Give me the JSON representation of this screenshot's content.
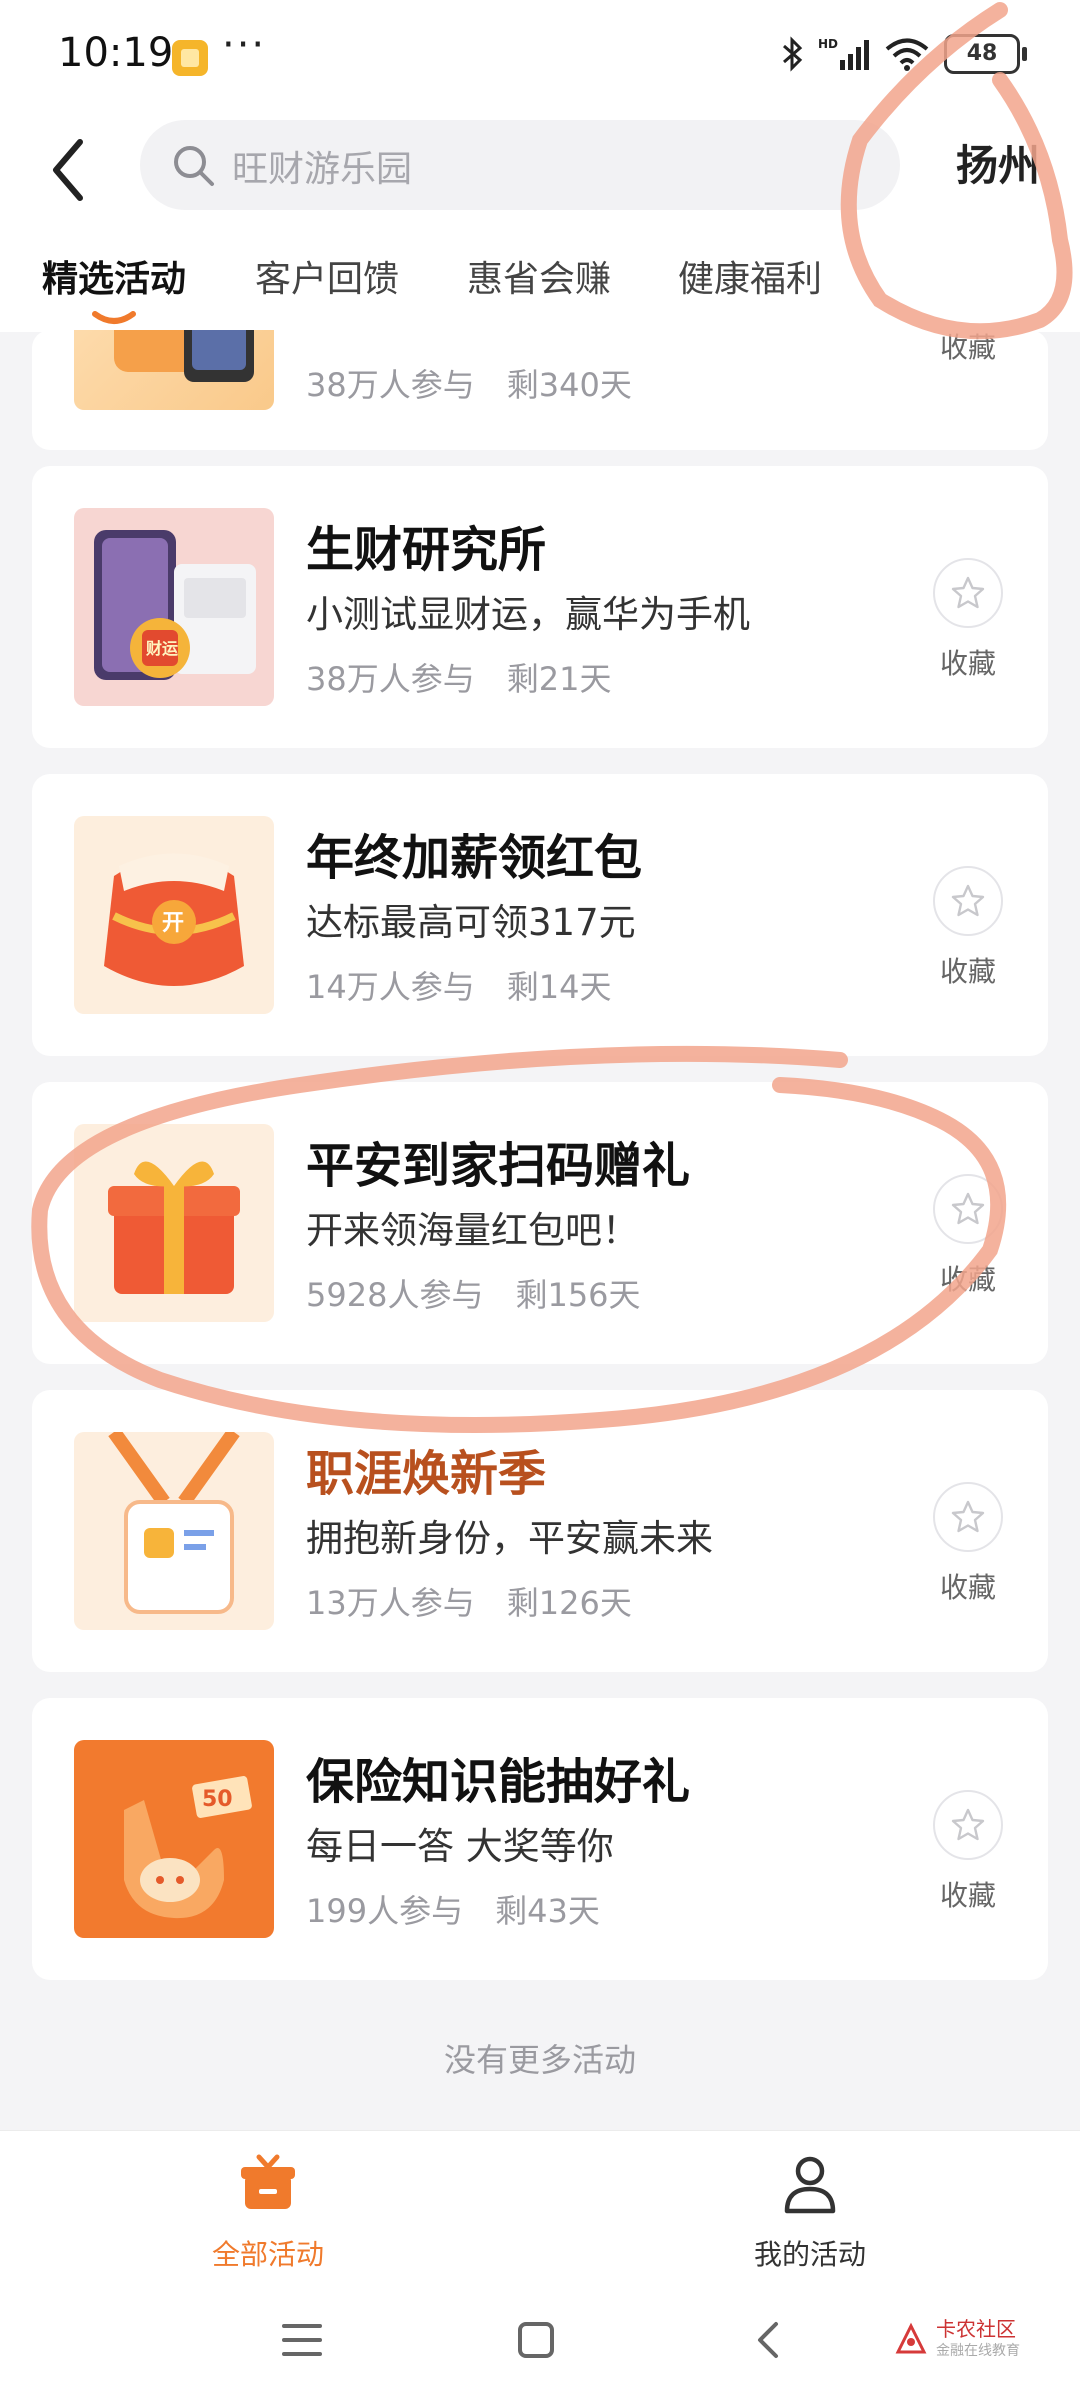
{
  "status_bar": {
    "time": "10:19",
    "dots": "···",
    "battery": "48"
  },
  "header": {
    "search_placeholder": "旺财游乐园",
    "city": "扬州",
    "tabs": [
      "精选活动",
      "客户回馈",
      "惠省会赚",
      "健康福利"
    ],
    "active_tab": 0
  },
  "cards": [
    {
      "title": "",
      "subtitle": "",
      "participants": "38万人参与",
      "remaining": "剩340天",
      "fav_label": "收藏"
    },
    {
      "title": "生财研究所",
      "subtitle": "小测试显财运，赢华为手机",
      "participants": "38万人参与",
      "remaining": "剩21天",
      "fav_label": "收藏",
      "thumb_badge": "财运"
    },
    {
      "title": "年终加薪领红包",
      "subtitle": "达标最高可领317元",
      "participants": "14万人参与",
      "remaining": "剩14天",
      "fav_label": "收藏",
      "thumb_badge": "开"
    },
    {
      "title": "平安到家扫码赠礼",
      "subtitle": "开来领海量红包吧！",
      "participants": "5928人参与",
      "remaining": "剩156天",
      "fav_label": "收藏"
    },
    {
      "title": "职涯焕新季",
      "subtitle": "拥抱新身份，平安赢未来",
      "participants": "13万人参与",
      "remaining": "剩126天",
      "fav_label": "收藏"
    },
    {
      "title": "保险知识能抽好礼",
      "subtitle": "每日一答 大奖等你",
      "participants": "199人参与",
      "remaining": "剩43天",
      "fav_label": "收藏",
      "thumb_badge": "50"
    }
  ],
  "no_more": "没有更多活动",
  "bottom_nav": {
    "all": "全部活动",
    "mine": "我的活动"
  },
  "watermark": {
    "name": "卡农社区",
    "sub": "金融在线教育"
  },
  "colors": {
    "accent": "#f07a2c",
    "annotation": "#f2a48c"
  }
}
